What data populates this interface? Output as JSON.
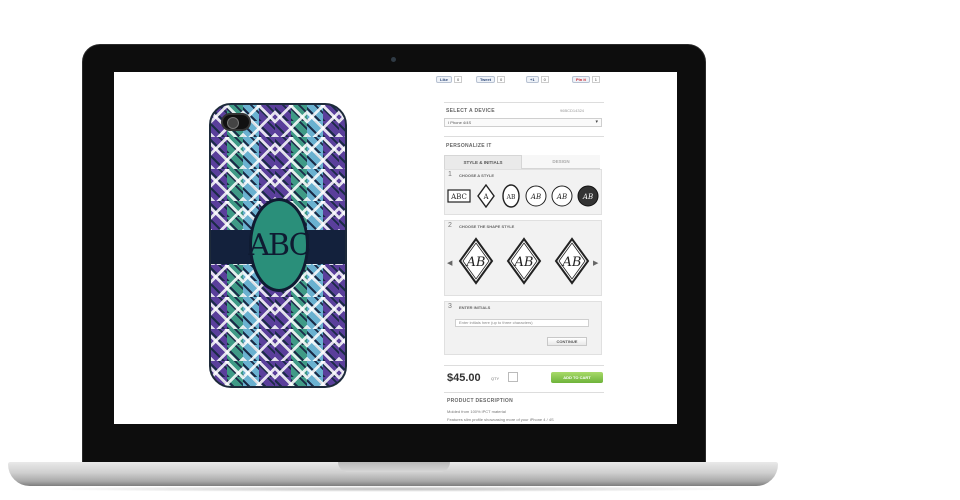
{
  "social": [
    {
      "label": "Like",
      "count": "0"
    },
    {
      "label": "Tweet",
      "count": "0"
    },
    {
      "label": "+1",
      "count": "0"
    },
    {
      "label": "Pin it",
      "count": "1"
    }
  ],
  "device": {
    "title": "SELECT A DEVICE",
    "sku": "96BCD14324",
    "selected": "I Phone 4/4S"
  },
  "personalize": {
    "title": "PERSONALIZE IT",
    "tabs": [
      {
        "label": "STYLE & INITIALS"
      },
      {
        "label": "DESIGN"
      }
    ],
    "steps": [
      {
        "num": "1",
        "title": "CHOOSE A STYLE"
      },
      {
        "num": "2",
        "title": "CHOOSE THE SHAPE STYLE"
      },
      {
        "num": "3",
        "title": "ENTER INITIALS"
      }
    ],
    "style_icons": [
      "ABC",
      "A",
      "AB",
      "AB",
      "AB",
      "AB"
    ],
    "shape_samples": [
      "AB",
      "AB",
      "AB"
    ],
    "initials_placeholder": "Enter initials here (up to three characters)",
    "continue_label": "CONTINUE"
  },
  "case_monogram": "ABC",
  "purchase": {
    "price": "$45.00",
    "qty_label": "QTY",
    "cart_label": "ADD TO CART"
  },
  "description": {
    "title": "PRODUCT DESCRIPTION",
    "line1": "Molded from 100% iPCT material",
    "line2": "Features slim profile showcasing more of your iPhone 4 / 4S"
  }
}
